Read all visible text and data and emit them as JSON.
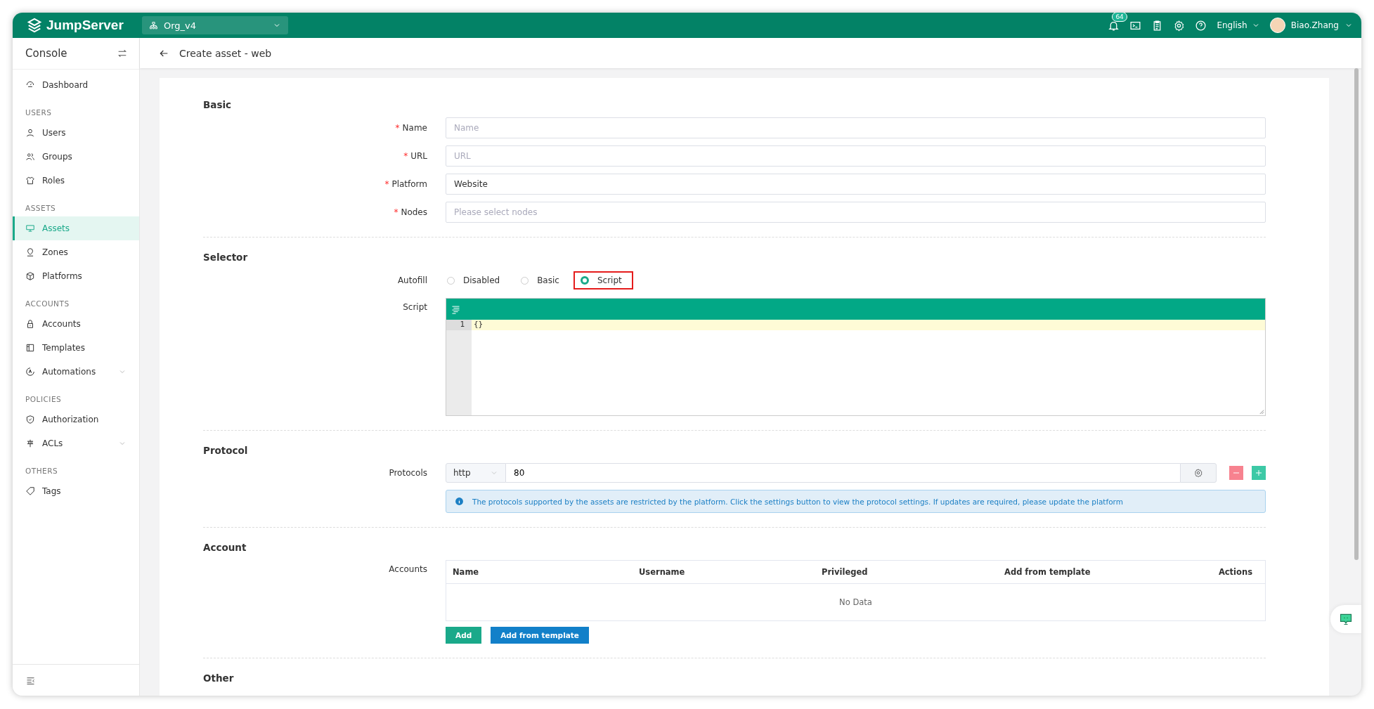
{
  "topbar": {
    "logo": "JumpServer",
    "org": "Org_v4",
    "notification_count": "64",
    "language": "English",
    "user": "Biao.Zhang"
  },
  "sidebar": {
    "title": "Console",
    "items": [
      {
        "kind": "link",
        "label": "Dashboard",
        "selected": false,
        "submenu": false
      },
      {
        "kind": "heading",
        "label": "USERS"
      },
      {
        "kind": "link",
        "label": "Users",
        "selected": false,
        "submenu": false
      },
      {
        "kind": "link",
        "label": "Groups",
        "selected": false,
        "submenu": false
      },
      {
        "kind": "link",
        "label": "Roles",
        "selected": false,
        "submenu": false
      },
      {
        "kind": "heading",
        "label": "ASSETS"
      },
      {
        "kind": "link",
        "label": "Assets",
        "selected": true,
        "submenu": false
      },
      {
        "kind": "link",
        "label": "Zones",
        "selected": false,
        "submenu": false
      },
      {
        "kind": "link",
        "label": "Platforms",
        "selected": false,
        "submenu": false
      },
      {
        "kind": "heading",
        "label": "ACCOUNTS"
      },
      {
        "kind": "link",
        "label": "Accounts",
        "selected": false,
        "submenu": false
      },
      {
        "kind": "link",
        "label": "Templates",
        "selected": false,
        "submenu": false
      },
      {
        "kind": "link",
        "label": "Automations",
        "selected": false,
        "submenu": true
      },
      {
        "kind": "heading",
        "label": "POLICIES"
      },
      {
        "kind": "link",
        "label": "Authorization",
        "selected": false,
        "submenu": false
      },
      {
        "kind": "link",
        "label": "ACLs",
        "selected": false,
        "submenu": true
      },
      {
        "kind": "heading",
        "label": "OTHERS"
      },
      {
        "kind": "link",
        "label": "Tags",
        "selected": false,
        "submenu": false
      }
    ]
  },
  "page": {
    "title": "Create asset - web"
  },
  "basic": {
    "title": "Basic",
    "fields": [
      {
        "label": "Name",
        "required_mark": "*",
        "placeholder": "Name"
      },
      {
        "label": "URL",
        "required_mark": "*",
        "placeholder": "URL"
      },
      {
        "label": "Platform",
        "required_mark": "*",
        "value": "Website"
      },
      {
        "label": "Nodes",
        "required_mark": "*",
        "placeholder": "Please select nodes"
      }
    ]
  },
  "selector": {
    "title": "Selector",
    "autofill_label": "Autofill",
    "options": [
      {
        "label": "Disabled",
        "selected": false,
        "highlighted": false
      },
      {
        "label": "Basic",
        "selected": false,
        "highlighted": false
      },
      {
        "label": "Script",
        "selected": true,
        "highlighted": true
      }
    ],
    "script_label": "Script",
    "lines": [
      {
        "number": "1",
        "text": "{}"
      }
    ]
  },
  "protocol": {
    "title": "Protocol",
    "label": "Protocols",
    "rows": [
      {
        "name": "http",
        "port": "80"
      }
    ],
    "info": "The protocols supported by the assets are restricted by the platform. Click the settings button to view the protocol settings. If updates are required, please update the platform"
  },
  "account": {
    "title": "Account",
    "label": "Accounts",
    "columns": [
      "Name",
      "Username",
      "Privileged",
      "Add from template",
      "Actions"
    ],
    "empty_text": "No Data",
    "buttons": [
      {
        "label": "Add",
        "kind": "primary"
      },
      {
        "label": "Add from template",
        "kind": "info"
      }
    ]
  },
  "other": {
    "title": "Other"
  }
}
